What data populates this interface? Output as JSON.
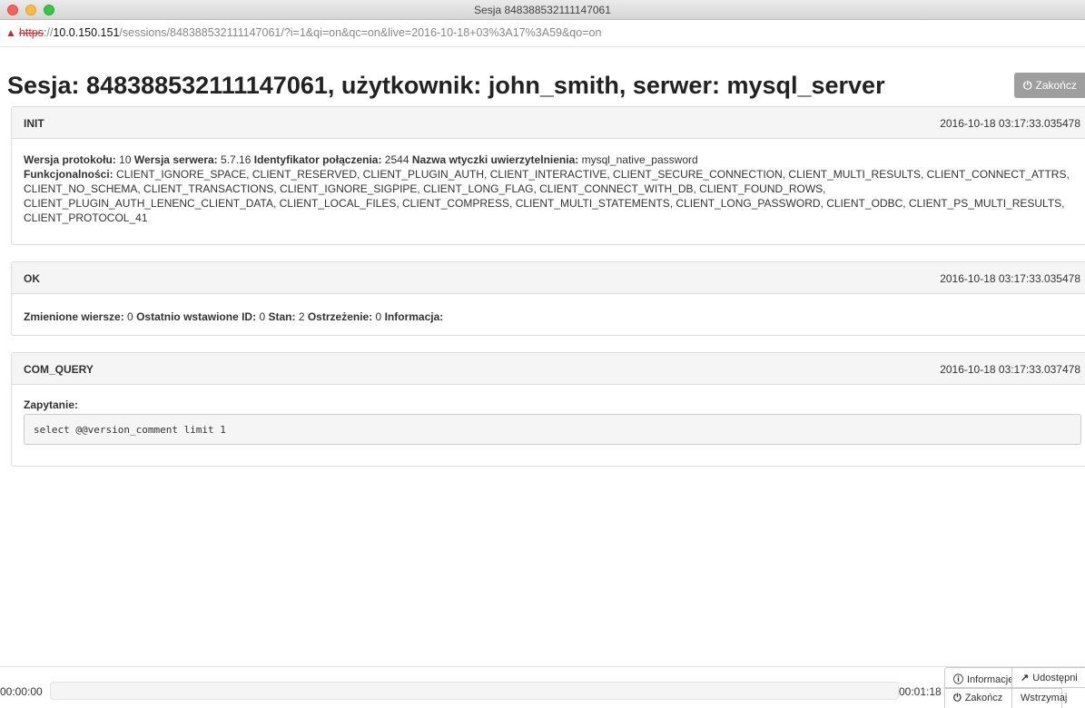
{
  "window": {
    "title": "Sesja 848388532111147061"
  },
  "address": {
    "warning_icon": "warning-triangle-icon",
    "scheme": "https",
    "separator": "://",
    "host": "10.0.150.151",
    "path": "/sessions/848388532111147061/?i=1&qi=on&qc=on&live=2016-10-18+03%3A17%3A59&qo=on"
  },
  "header": {
    "title": "Sesja: 848388532111147061, użytkownik: john_smith, serwer: mysql_server",
    "end_button": "Zakończ"
  },
  "panels": [
    {
      "name": "INIT",
      "timestamp": "2016-10-18 03:17:33.035478",
      "line1": {
        "protocol_label": "Wersja protokołu:",
        "protocol_value": "10",
        "server_label": "Wersja serwera:",
        "server_value": "5.7.16",
        "conn_label": "Identyfikator połączenia:",
        "conn_value": "2544",
        "plugin_label": "Nazwa wtyczki uwierzytelnienia:",
        "plugin_value": "mysql_native_password"
      },
      "capabilities_label": "Funkcjonalności:",
      "capabilities_lines": [
        "CLIENT_IGNORE_SPACE, CLIENT_RESERVED, CLIENT_PLUGIN_AUTH, CLIENT_INTERACTIVE, CLIENT_SECURE_CONNECTION, CLIENT_MULTI_RESULTS, CLIENT_CONNECT_ATTRS,",
        "CLIENT_NO_SCHEMA, CLIENT_TRANSACTIONS, CLIENT_IGNORE_SIGPIPE, CLIENT_LONG_FLAG, CLIENT_CONNECT_WITH_DB, CLIENT_FOUND_ROWS,",
        "CLIENT_PLUGIN_AUTH_LENENC_CLIENT_DATA, CLIENT_LOCAL_FILES, CLIENT_COMPRESS, CLIENT_MULTI_STATEMENTS, CLIENT_LONG_PASSWORD, CLIENT_ODBC, CLIENT_PS_MULTI_RESULTS,",
        "CLIENT_PROTOCOL_41"
      ]
    },
    {
      "name": "OK",
      "timestamp": "2016-10-18 03:17:33.035478",
      "fields": {
        "changed_label": "Zmienione wiersze:",
        "changed_value": "0",
        "lastid_label": "Ostatnio wstawione ID:",
        "lastid_value": "0",
        "status_label": "Stan:",
        "status_value": "2",
        "warn_label": "Ostrzeżenie:",
        "warn_value": "0",
        "info_label": "Informacja:"
      }
    },
    {
      "name": "COM_QUERY",
      "timestamp": "2016-10-18 03:17:33.037478",
      "query_label": "Zapytanie:",
      "query": "select @@version_comment limit 1"
    }
  ],
  "player": {
    "time_start": "00:00:00",
    "time_end": "00:01:18",
    "progress": 0,
    "info_button": "Informacje",
    "share_button": "Udostępni",
    "end_button": "Zakończ",
    "pause_button": "Wstrzymaj"
  }
}
